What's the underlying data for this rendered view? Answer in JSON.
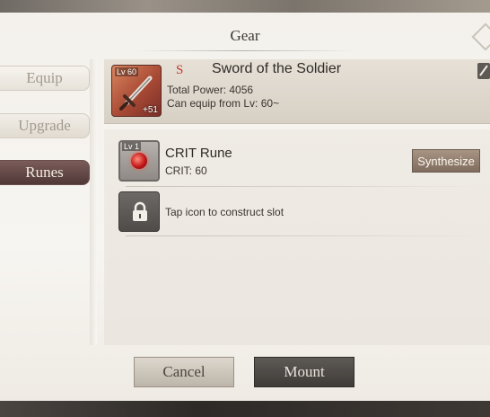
{
  "window": {
    "title": "Gear"
  },
  "tabs": [
    {
      "label": "Equip",
      "active": false
    },
    {
      "label": "Upgrade",
      "active": false
    },
    {
      "label": "Runes",
      "active": true
    }
  ],
  "item": {
    "level_badge": "Lv 60",
    "enhance_badge": "+51",
    "grade": "S",
    "name": "Sword of the Soldier",
    "power": "Total Power: 4056",
    "equip_level": "Can equip from Lv: 60~",
    "icon": "sword-icon"
  },
  "rune": {
    "level_badge": "Lv 1",
    "name": "CRIT Rune",
    "stat": "CRIT: 60",
    "icon": "red-gem-icon",
    "synthesize_label": "Synthesize"
  },
  "empty_slot": {
    "icon": "lock-icon",
    "hint": "Tap icon to construct slot"
  },
  "actions": {
    "cancel_label": "Cancel",
    "mount_label": "Mount"
  },
  "colors": {
    "active_tab": "#5e4443",
    "grade_s": "#c53a2e",
    "mount_button": "#4a4643"
  }
}
